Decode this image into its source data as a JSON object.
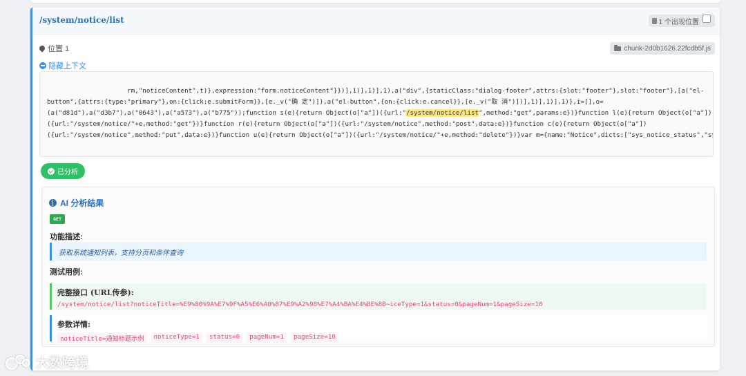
{
  "card": {
    "path": "/system/notice/list",
    "occurrence_badge": "1 个出现位置",
    "location_label": "位置 1",
    "chunk_file": "chunk-2d0b1626.22fcdb5f.js",
    "toggle_context_label": "隐藏上下文"
  },
  "code": {
    "lines": [
      "                     rm,\"noticeContent\",t)},expression:\"form.noticeContent\"}})],1)],1)],1),a(\"div\",{staticClass:\"dialog-footer\",attrs:{slot:\"footer\"},slot:\"footer\"},[a(\"el-",
      "button\",{attrs:{type:\"primary\"},on:{click:e.submitForm}},[e._v(\"确 定\")]),a(\"el-button\",{on:{click:e.cancel}},[e._v(\"取 消\")])],1)],1)],1)},i=[],o=",
      "(a(\"d81d\"),a(\"d3b7\"),a(\"0643\"),a(\"a573\"),a(\"b775\"));function s(e){return Object(o[\"a\"])({url:\"",
      "({url:\"/system/notice/\"+e,method:\"get\"})}function r(e){return Object(o[\"a\"])({url:\"/system/notice\",method:\"post\",data:e})}function c(e){return Object(o[\"a\"])",
      "({url:\"/system/notice\",method:\"put\",data:e})}function u(e){return Object(o[\"a\"])({url:\"/system/notice/\"+e,method:\"delete\"})}var m={name:\"Notice\",dicts:[\"sys_notice_status\",\"sys_notic"
    ],
    "line3_highlight": "/system/notice/list",
    "line3_after": "\",method:\"get\",params:e})}function l(e){return Object(o[\"a\"])"
  },
  "status_button": "已分析",
  "ai": {
    "title": "AI 分析结果",
    "method": "GET",
    "function_label": "功能描述:",
    "description": "获取系统通知列表，支持分页和条件查询",
    "test_label": "测试用例:",
    "full_url_label": "完整接口 (URL传参):",
    "full_url": "/system/notice/list?noticeTitle=%E9%80%9A%E7%9F%A5%E6%A0%87%E9%A2%98%E7%A4%BA%E4%BE%8B~iceType=1&status=0&pageNum=1&pageSize=10",
    "params_label": "参数详情:",
    "params": [
      "noticeTitle=通知标题示例",
      "noticeType=1",
      "status=0",
      "pageNum=1",
      "pageSize=10"
    ]
  },
  "watermark": "大数跨境",
  "colors": {
    "accent": "#3a8ee6",
    "success": "#2fbf66",
    "param": "#d9477e"
  }
}
